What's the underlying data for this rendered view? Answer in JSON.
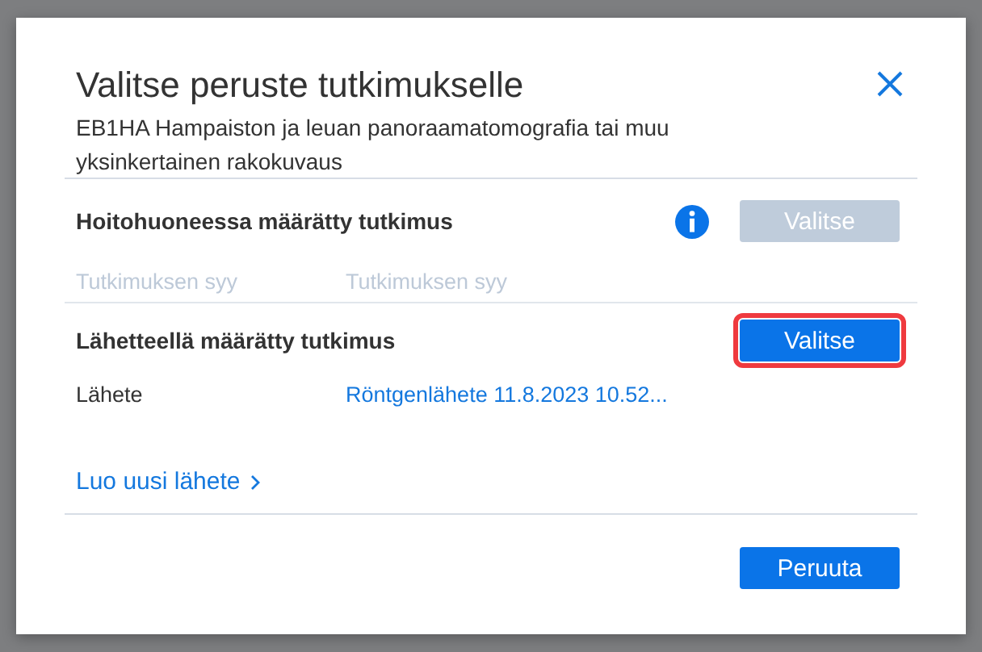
{
  "dialog": {
    "title": "Valitse peruste tutkimukselle",
    "subtitle": "EB1HA Hampaiston ja leuan panoraamatomografia tai muu yksinkertainen rakokuvaus"
  },
  "sections": [
    {
      "title": "Hoitohuoneessa määrätty tutkimus",
      "info": true,
      "button": {
        "label": "Valitse",
        "disabled": true,
        "highlighted": false
      },
      "fields": [
        {
          "placeholder": "Tutkimuksen syy"
        },
        {
          "placeholder": "Tutkimuksen syy"
        }
      ]
    },
    {
      "title": "Lähetteellä määrätty tutkimus",
      "info": false,
      "button": {
        "label": "Valitse",
        "disabled": false,
        "highlighted": true
      },
      "row": {
        "label": "Lähete",
        "link": "Röntgenlähete 11.8.2023 10.52..."
      }
    }
  ],
  "create_link": "Luo uusi lähete",
  "buttons": [
    {
      "label": "Peruuta"
    }
  ]
}
